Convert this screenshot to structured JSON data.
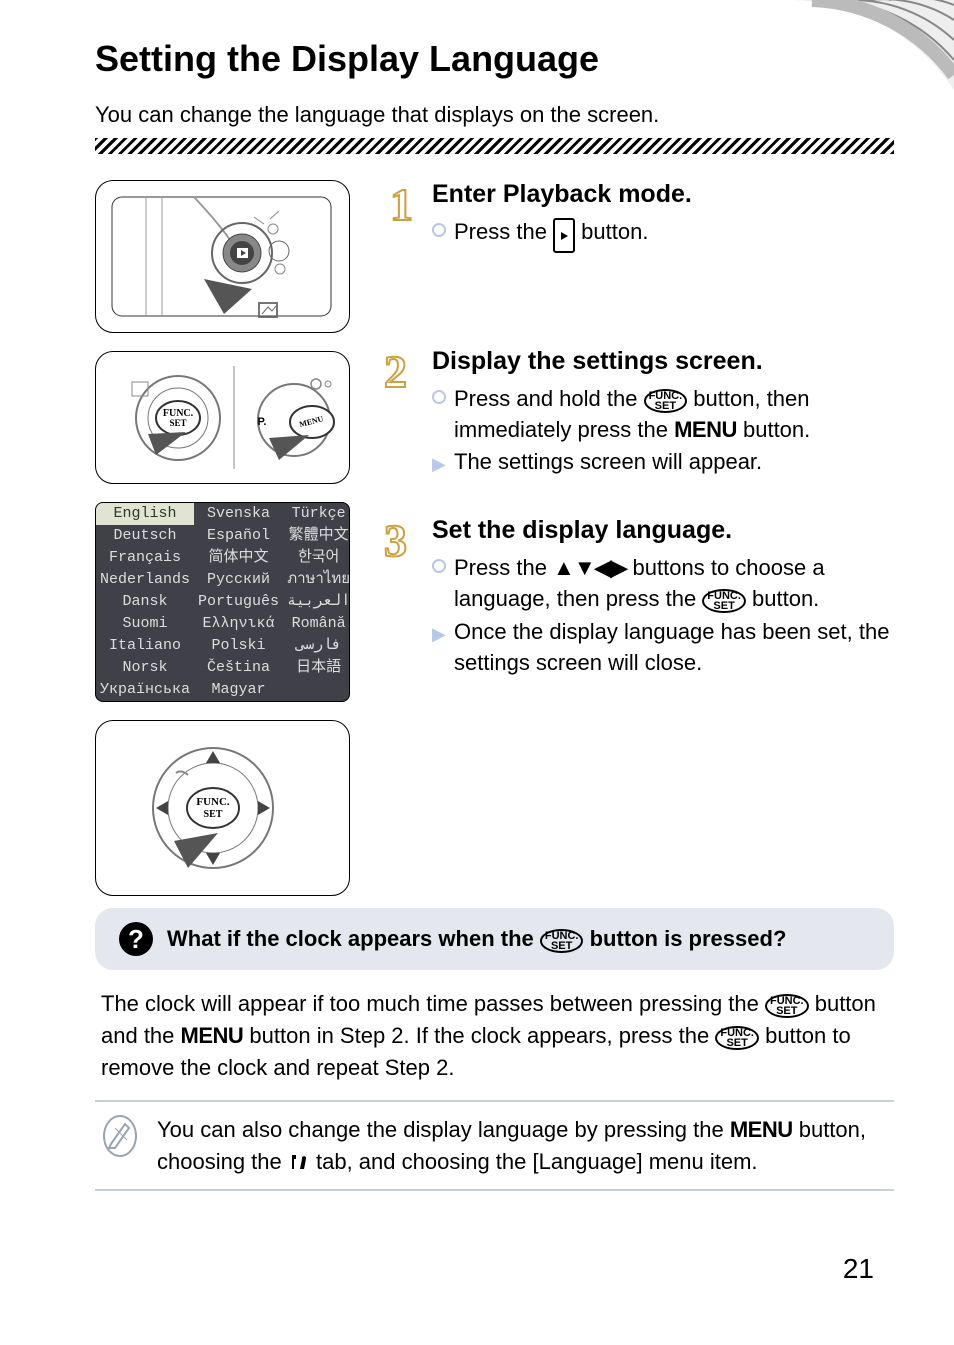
{
  "page": {
    "title": "Setting the Display Language",
    "intro": "You can change the language that displays on the screen.",
    "number": "21"
  },
  "steps": [
    {
      "heading": "Enter Playback mode.",
      "bullets": [
        {
          "kind": "circle",
          "pre": "Press the ",
          "post": " button.",
          "icon": "playback"
        }
      ]
    },
    {
      "heading": "Display the settings screen.",
      "bullets": [
        {
          "kind": "circle",
          "pre": "Press and hold the ",
          "mid": " button, then immediately press the ",
          "icon": "func",
          "icon2": "menu",
          "post": " button."
        },
        {
          "kind": "arrow",
          "text": "The settings screen will appear."
        }
      ]
    },
    {
      "heading": "Set the display language.",
      "bullets": [
        {
          "kind": "circle",
          "pre": "Press the ",
          "mid": " buttons to choose a language, then press the ",
          "icon": "arrows",
          "icon2": "func",
          "post": " button."
        },
        {
          "kind": "arrow",
          "text": "Once the display language has been set, the settings screen will close."
        }
      ]
    }
  ],
  "language_table": [
    [
      "English",
      "Svenska",
      "Türkçe"
    ],
    [
      "Deutsch",
      "Español",
      "繁體中文"
    ],
    [
      "Français",
      "简体中文",
      "한국어"
    ],
    [
      "Nederlands",
      "Русский",
      "ภาษาไทย"
    ],
    [
      "Dansk",
      "Português",
      "العربية"
    ],
    [
      "Suomi",
      "Ελληνικά",
      "Română"
    ],
    [
      "Italiano",
      "Polski",
      "فارسی"
    ],
    [
      "Norsk",
      "Čeština",
      "日本語"
    ],
    [
      "Українська",
      "Magyar",
      ""
    ]
  ],
  "tip": {
    "heading_pre": "What if the clock appears when the ",
    "heading_post": " button is pressed?",
    "body_1": "The clock will appear if too much time passes between pressing the ",
    "body_2": " button and the ",
    "body_3": " button in Step 2. If the clock appears, press the ",
    "body_4": " button to remove the clock and repeat Step 2."
  },
  "note": {
    "pre": "You can also change the display language by pressing the ",
    "mid": " button, choosing the ",
    "post": " tab, and choosing the [Language] menu item."
  },
  "labels": {
    "func_top": "FUNC.",
    "func_bot": "SET",
    "menu": "MENU"
  }
}
